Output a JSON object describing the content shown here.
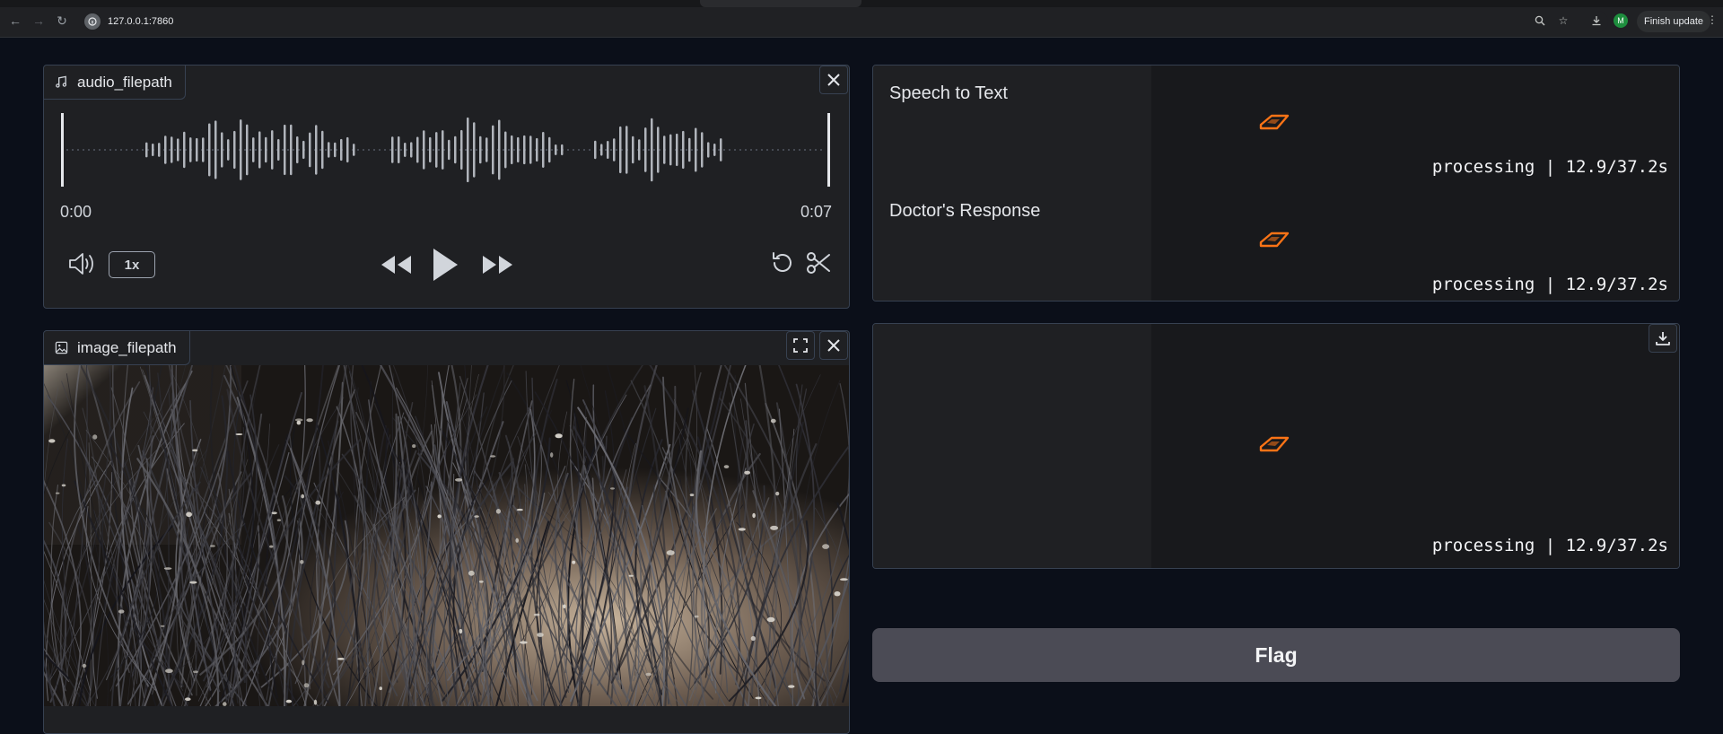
{
  "browser": {
    "url": "127.0.0.1:7860",
    "update_label": "Finish update",
    "profile_initial": "M"
  },
  "audio": {
    "label": "audio_filepath",
    "time_start": "0:00",
    "time_end": "0:07",
    "playback_rate": "1x"
  },
  "image": {
    "label": "image_filepath"
  },
  "outputs": {
    "speech_label": "Speech to Text",
    "speech_eta": "processing | 12.9/37.2s",
    "doctor_label": "Doctor's Response",
    "doctor_eta": "processing | 12.9/37.2s",
    "audio_eta": "processing | 12.9/37.2s"
  },
  "flag_label": "Flag",
  "colors": {
    "background": "#0b0f19",
    "panel": "#1f2023",
    "loader_accent": "#f97316",
    "flag_button": "#4b4b55"
  }
}
